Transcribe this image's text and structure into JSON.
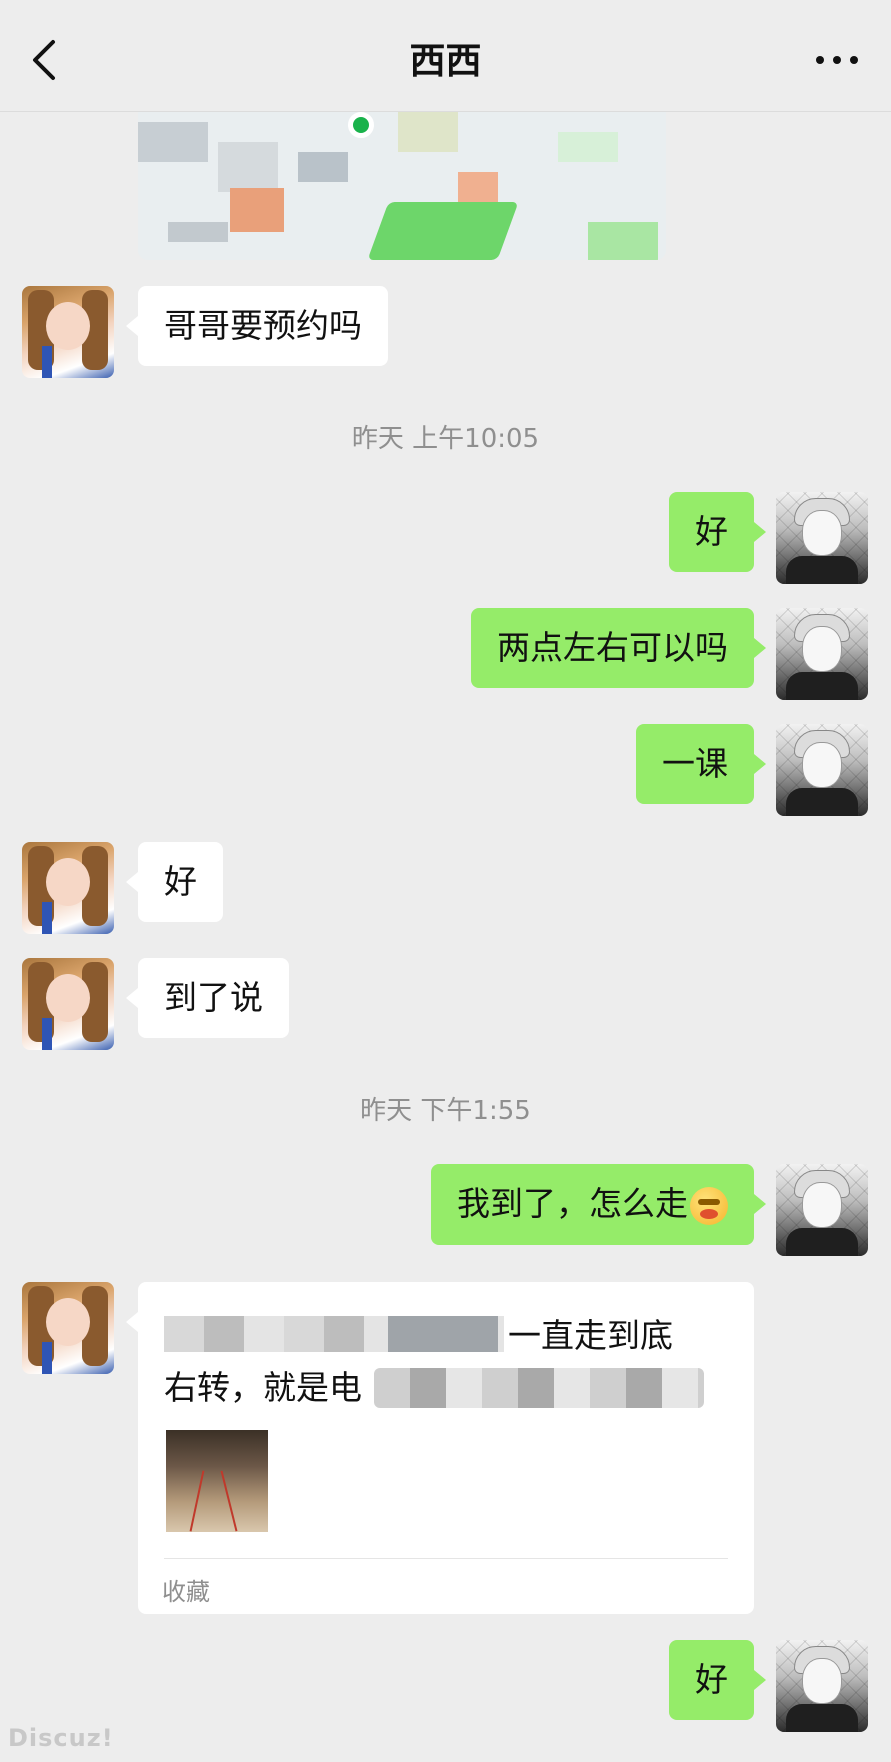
{
  "header": {
    "title": "西西",
    "back_icon": "chevron-left-icon",
    "more_icon": "more-dots-icon"
  },
  "messages": {
    "m1": "哥哥要预约吗",
    "ts1": "昨天 上午10:05",
    "m2": "好",
    "m3": "两点左右可以吗",
    "m4": "一课",
    "m5": "好",
    "m6": "到了说",
    "ts2": "昨天 下午1:55",
    "m7": "我到了，怎么走",
    "m7_emoji": "hungry-emoji-icon",
    "m8_line1": "一直走到底",
    "m8_line2": "右转，就是电",
    "m8_label": "收藏",
    "m9": "好"
  },
  "watermark": "Discuz!",
  "colors": {
    "background": "#ededed",
    "outgoing_bubble": "#95ec69",
    "incoming_bubble": "#ffffff",
    "timestamp": "#8f8f8f"
  }
}
